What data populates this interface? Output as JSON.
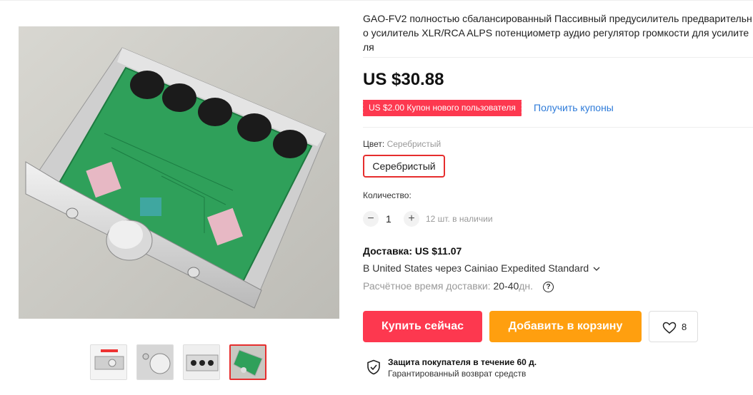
{
  "product": {
    "title": "GAO-FV2 полностью сбалансированный Пассивный предусилитель предварительно усилитель XLR/RCA ALPS потенциометр аудио регулятор громкости для усилителя",
    "price": "US $30.88",
    "coupon_badge": "US $2.00 Купон нового пользователя",
    "coupon_link": "Получить купоны"
  },
  "options": {
    "color_label": "Цвет:",
    "color_value": "Серебристый",
    "color_button": "Серебристый"
  },
  "quantity": {
    "label": "Количество:",
    "minus": "−",
    "plus": "+",
    "value": "1",
    "stock": "12 шт. в наличии"
  },
  "shipping": {
    "title": "Доставка: US $11.07",
    "route": "В United States через Cainiao Expedited Standard",
    "route_icon": "chevron-down-icon",
    "time_label": "Расчётное время доставки:",
    "time_value": "20-40",
    "time_unit": "дн.",
    "help_icon": "?"
  },
  "actions": {
    "buy_now": "Купить сейчас",
    "add_to_cart": "Добавить в корзину",
    "wishlist_count": "8"
  },
  "protection": {
    "title": "Защита покупателя в течение 60 д.",
    "subtitle": "Гарантированный возврат средств"
  },
  "gallery": {
    "thumbnail_count": 4,
    "active_index": 3
  },
  "colors": {
    "accent_red": "#fd384f",
    "accent_orange": "#ff9f0f",
    "link_blue": "#2e7bd9",
    "selected_border": "#e62e2e"
  }
}
